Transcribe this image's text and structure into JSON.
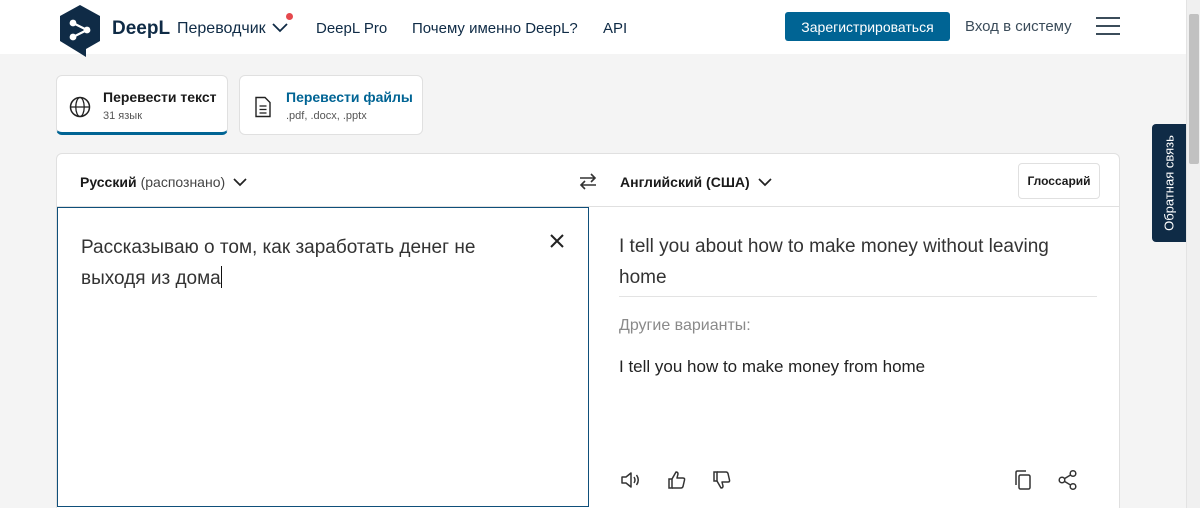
{
  "header": {
    "brand": "DeepL",
    "product": "Переводчик",
    "nav": [
      "DeepL Pro",
      "Почему именно DeepL?",
      "API"
    ],
    "register_label": "Зарегистрироваться",
    "login_label": "Вход в систему"
  },
  "feedback_label": "Обратная связь",
  "tabs": [
    {
      "title": "Перевести текст",
      "subtitle": "31 язык"
    },
    {
      "title": "Перевести файлы",
      "subtitle": ".pdf, .docx, .pptx"
    }
  ],
  "source": {
    "language": "Русский",
    "detected": "(распознано)",
    "text": "Рассказываю о том, как заработать денег не выходя из дома"
  },
  "target": {
    "language": "Английский (США)",
    "glossary_label": "Глоссарий",
    "text": "I tell you about how to make money without leaving home",
    "alternatives_label": "Другие варианты:",
    "alternatives": [
      "I tell you how to make money from home"
    ]
  },
  "colors": {
    "brand_navy": "#0f2b46",
    "accent_blue": "#006494",
    "tab_title_blue": "#006494",
    "notification_red": "#e5484d"
  },
  "icons": [
    "deepl-logo-icon",
    "chevron-down-icon",
    "hamburger-menu-icon",
    "globe-icon",
    "document-icon",
    "swap-icon",
    "close-icon",
    "speaker-icon",
    "thumbs-up-icon",
    "thumbs-down-icon",
    "copy-icon",
    "share-icon"
  ]
}
